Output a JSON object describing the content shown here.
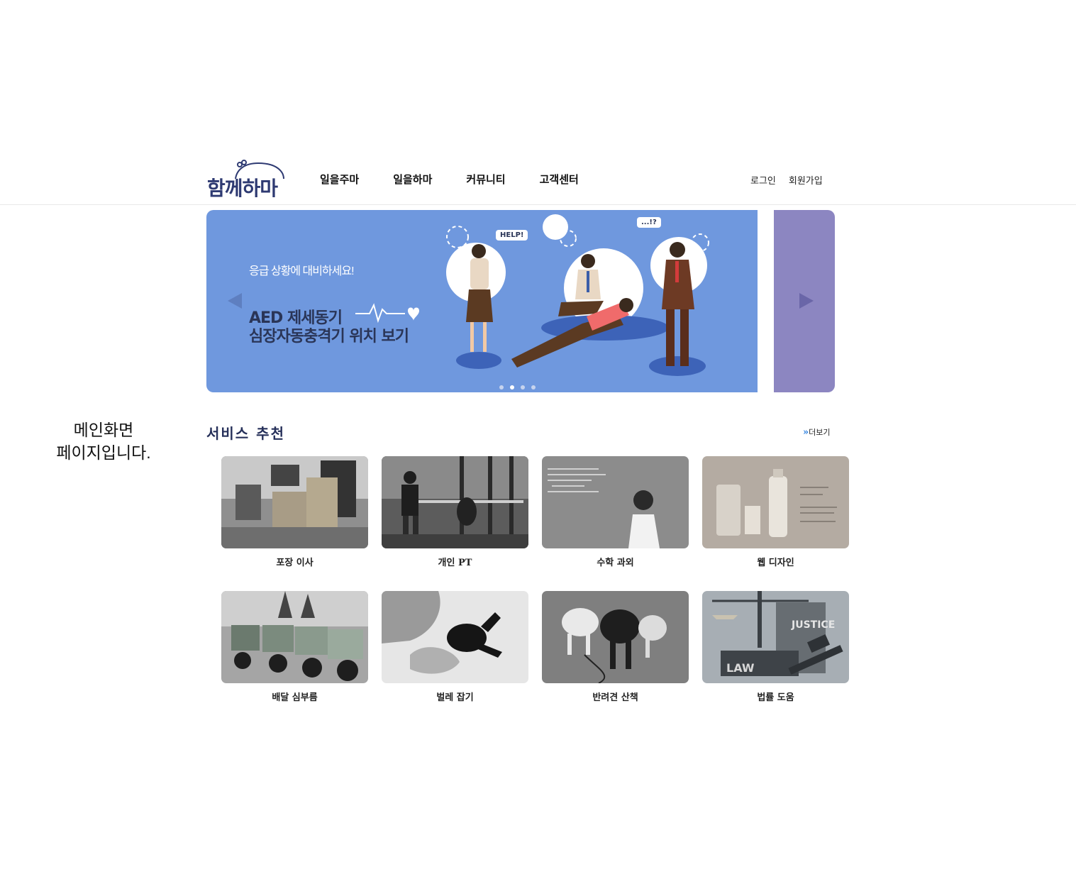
{
  "header": {
    "logo_text": "함께하마",
    "nav": [
      "일을주마",
      "일을하마",
      "커뮤니티",
      "고객센터"
    ],
    "login": "로그인",
    "signup": "회원가입"
  },
  "banner": {
    "subtitle": "응급 상황에 대비하세요!",
    "title_line1": "AED 제세동기",
    "title_line2": "심장자동충격기 위치 보기",
    "bubble_help": "HELP!",
    "bubble_question": "...!?",
    "slide_count": 4,
    "active_slide": 1,
    "colors": {
      "current": "#6f98de",
      "next": "#8c86c1",
      "title": "#2a3557"
    }
  },
  "side_note": {
    "line1": "메인화면",
    "line2": "페이지입니다."
  },
  "services": {
    "title": "서비스 추천",
    "more_label": "더보기",
    "items": [
      {
        "label": "포장 이사",
        "image": "moving-boxes-photo"
      },
      {
        "label": "개인 PT",
        "image": "gym-training-photo"
      },
      {
        "label": "수학 과외",
        "image": "math-tutoring-photo"
      },
      {
        "label": "웹 디자인",
        "image": "web-design-product-photo"
      },
      {
        "label": "배달 심부름",
        "image": "delivery-scooters-photo"
      },
      {
        "label": "벌레 잡기",
        "image": "beetle-photo"
      },
      {
        "label": "반려견 산책",
        "image": "dog-walking-photo"
      },
      {
        "label": "법률 도움",
        "image": "law-justice-photo"
      }
    ]
  }
}
